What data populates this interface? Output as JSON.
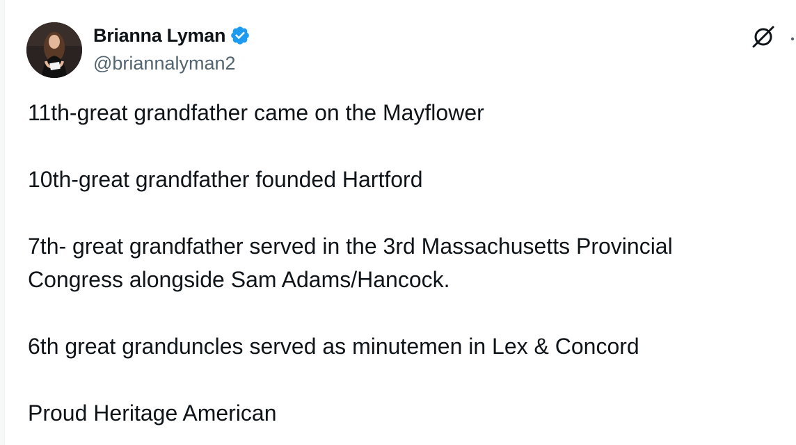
{
  "user": {
    "display_name": "Brianna Lyman",
    "handle": "@briannalyman2",
    "verified": true,
    "verified_color": "#1d9bf0"
  },
  "icons": {
    "verified": "verified-badge-icon",
    "grok": "grok-icon",
    "more": "more-options-icon"
  },
  "tweet": {
    "lines": [
      "11th-great grandfather came on the Mayflower",
      "10th-great grandfather founded Hartford",
      "7th- great grandfather served in the 3rd Massachusetts Provincial",
      "Congress alongside Sam Adams/Hancock.",
      "6th great granduncles served as minutemen in Lex & Concord",
      "Proud Heritage American"
    ]
  }
}
